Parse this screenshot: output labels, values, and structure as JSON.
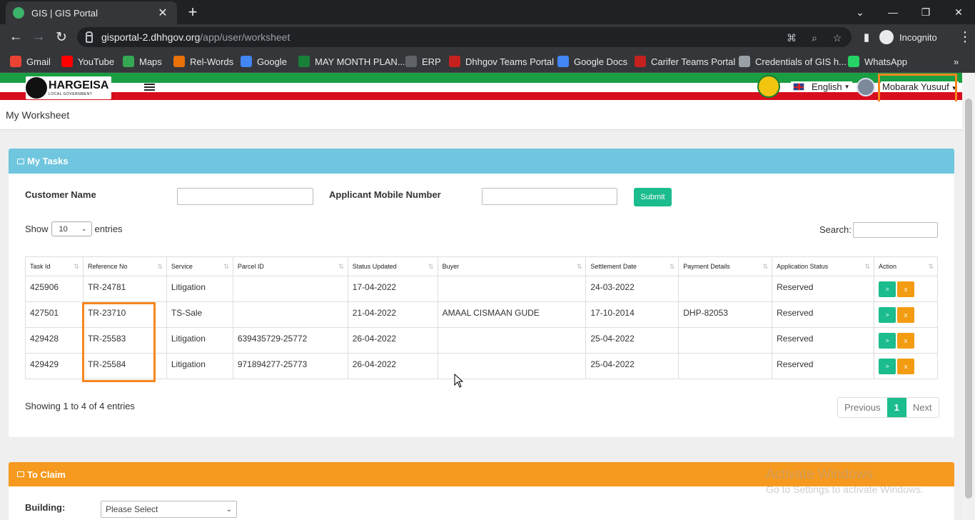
{
  "browser": {
    "tab_title": "GIS | GIS Portal",
    "url_host": "gisportal-2.dhhgov.org",
    "url_path": "/app/user/worksheet",
    "incognito_label": "Incognito",
    "bookmarks": [
      {
        "label": "Gmail",
        "color": "#ea4335"
      },
      {
        "label": "YouTube",
        "color": "#ff0000"
      },
      {
        "label": "Maps",
        "color": "#34a853"
      },
      {
        "label": "Rel-Words",
        "color": "#e8710a"
      },
      {
        "label": "Google",
        "color": "#4285f4"
      },
      {
        "label": "MAY MONTH PLAN...",
        "color": "#188038"
      },
      {
        "label": "ERP",
        "color": "#5f6368"
      },
      {
        "label": "Dhhgov Teams Portal",
        "color": "#c5221f"
      },
      {
        "label": "Google Docs",
        "color": "#4285f4"
      },
      {
        "label": "Carifer Teams Portal",
        "color": "#c5221f"
      },
      {
        "label": "Credentials of GIS h...",
        "color": "#9aa0a6"
      },
      {
        "label": "WhatsApp",
        "color": "#25d366"
      }
    ]
  },
  "header": {
    "logo_text": "HARGEISA",
    "logo_sub": "LOCAL GOVERNMENT",
    "language": "English",
    "user_name": "Mobarak Yusuuf"
  },
  "page": {
    "breadcrumb": "My Worksheet"
  },
  "tasks": {
    "title": "My Tasks",
    "customer_name_label": "Customer Name",
    "mobile_label": "Applicant Mobile Number",
    "submit_label": "Submit",
    "show_label": "Show",
    "entries_value": "10",
    "entries_label": "entries",
    "search_label": "Search:",
    "columns": [
      "Task Id",
      "Reference No",
      "Service",
      "Parcel ID",
      "Status Updated",
      "Buyer",
      "Settlement Date",
      "Payment Details",
      "Application Status",
      "Action"
    ],
    "rows": [
      {
        "task_id": "425906",
        "ref": "TR-24781",
        "service": "Litigation",
        "parcel": "",
        "status_updated": "17-04-2022",
        "buyer": "",
        "settlement": "24-03-2022",
        "payment": "",
        "app_status": "Reserved"
      },
      {
        "task_id": "427501",
        "ref": "TR-23710",
        "service": "TS-Sale",
        "parcel": "",
        "status_updated": "21-04-2022",
        "buyer": "AMAAL CISMAAN GUDE",
        "settlement": "17-10-2014",
        "payment": "DHP-82053",
        "app_status": "Reserved"
      },
      {
        "task_id": "429428",
        "ref": "TR-25583",
        "service": "Litigation",
        "parcel": "639435729-25772",
        "status_updated": "26-04-2022",
        "buyer": "",
        "settlement": "25-04-2022",
        "payment": "",
        "app_status": "Reserved"
      },
      {
        "task_id": "429429",
        "ref": "TR-25584",
        "service": "Litigation",
        "parcel": "971894277-25773",
        "status_updated": "26-04-2022",
        "buyer": "",
        "settlement": "25-04-2022",
        "payment": "",
        "app_status": "Reserved"
      }
    ],
    "go_label": ">",
    "reject_label": "x",
    "showing_text": "Showing 1 to 4 of 4 entries",
    "pager": {
      "previous": "Previous",
      "current": "1",
      "next": "Next"
    }
  },
  "claim": {
    "title": "To Claim",
    "building_label": "Building:",
    "building_select": "Please Select"
  },
  "watermark": {
    "line1": "Activate Windows",
    "line2": "Go to Settings to activate Windows."
  }
}
